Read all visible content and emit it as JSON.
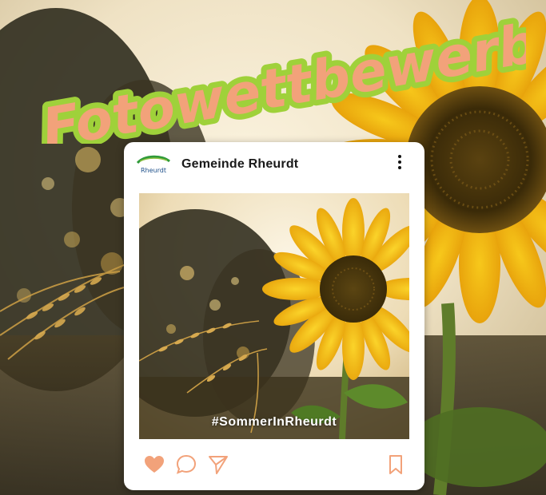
{
  "title": {
    "text": "Fotowettbewerb"
  },
  "post": {
    "account_name": "Gemeinde Rheurdt",
    "logo_text": "Rheurdt",
    "hashtag": "#SommerInRheurdt"
  },
  "colors": {
    "title_fill": "#f2a27a",
    "title_outline": "#9fd13a",
    "heart": "#f2a27a",
    "action_icons": "#f2a27a"
  },
  "icons": {
    "more": "more-vertical-icon",
    "like": "heart-icon",
    "comment": "comment-bubble-icon",
    "share": "paper-plane-icon",
    "save": "bookmark-icon"
  }
}
